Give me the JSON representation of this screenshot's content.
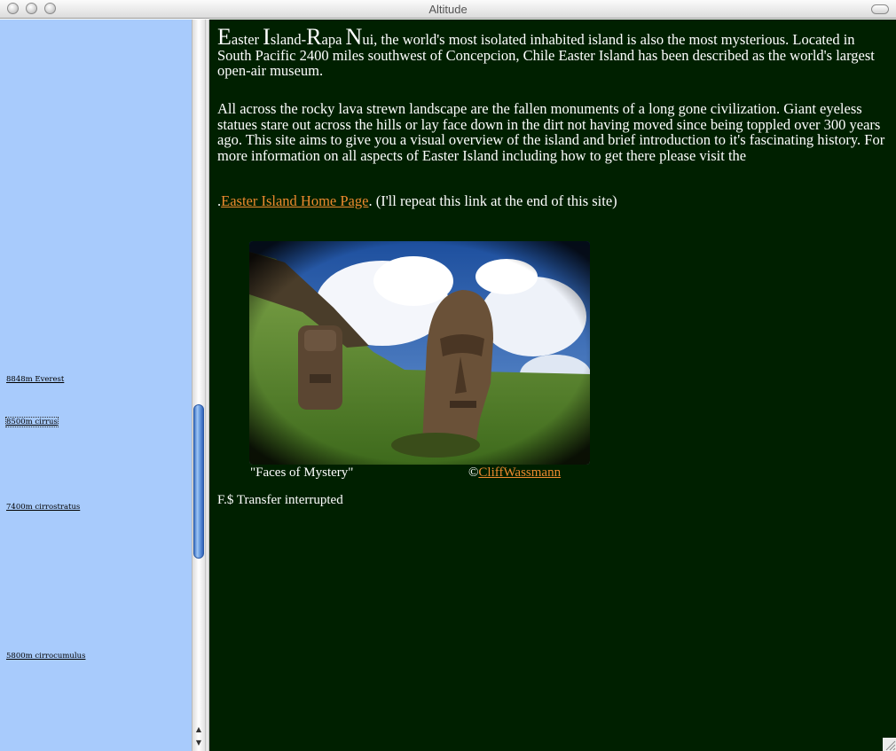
{
  "window": {
    "title": "Altitude"
  },
  "sidebar": {
    "links": [
      {
        "label": "8848m Everest"
      },
      {
        "label": "8500m cirrus"
      },
      {
        "label": "7400m cirrostratus"
      },
      {
        "label": "5800m cirrocumulus "
      }
    ]
  },
  "content": {
    "intro": {
      "cap1": "E",
      "w1": "aster ",
      "cap2": "I",
      "w2": "sland-",
      "cap3": "R",
      "w3": "apa ",
      "cap4": "N",
      "w4": "ui",
      "rest": ", the world's most isolated inhabited island is also the most mysterious. Located in South Pacific 2400 miles southwest of Concepcion, Chile Easter Island has been described as the world's largest open-air museum."
    },
    "paragraph2": "All across the rocky lava strewn landscape are the fallen monuments of a long gone civilization. Giant eyeless statues stare out across the hills or lay face down in the dirt not having moved since being toppled over 300 years ago. This site aims to give you a visual overview of the island and brief introduction to it's fascinating history. For more information on all aspects of Easter Island including how to get there please visit the",
    "link_prefix": ".",
    "link_text": "Easter Island Home Page",
    "link_suffix": ". (I'll repeat this link at the end of this site)",
    "photo_caption": "\"Faces of Mystery\"",
    "credit_symbol": "©",
    "credit_link": "CliffWassmann",
    "status_text": "F.$ Transfer interrupted"
  }
}
